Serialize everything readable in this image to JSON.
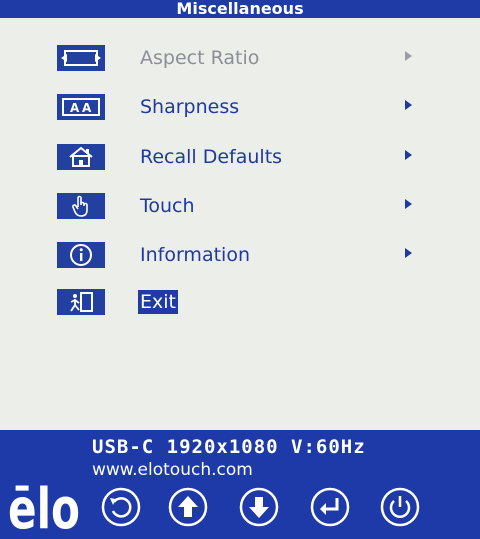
{
  "window": {
    "title": "Miscellaneous"
  },
  "menu": {
    "items": [
      {
        "label": "Aspect Ratio",
        "icon": "aspect-ratio-icon",
        "state": "disabled",
        "has_submenu": true
      },
      {
        "label": "Sharpness",
        "icon": "sharpness-icon",
        "state": "normal",
        "has_submenu": true
      },
      {
        "label": "Recall Defaults",
        "icon": "home-icon",
        "state": "normal",
        "has_submenu": true
      },
      {
        "label": "Touch",
        "icon": "touch-hand-icon",
        "state": "normal",
        "has_submenu": true
      },
      {
        "label": "Information",
        "icon": "info-icon",
        "state": "normal",
        "has_submenu": true
      },
      {
        "label": "Exit",
        "icon": "exit-door-icon",
        "state": "selected",
        "has_submenu": false
      }
    ]
  },
  "footer": {
    "brand": "ēlo",
    "model_line": "USB-C 1920x1080 V:60Hz",
    "url": "www.elotouch.com",
    "buttons": [
      {
        "icon": "back-icon"
      },
      {
        "icon": "up-arrow-icon"
      },
      {
        "icon": "down-arrow-icon"
      },
      {
        "icon": "enter-icon"
      },
      {
        "icon": "power-icon"
      }
    ]
  },
  "colors": {
    "panel_bg": "#eceeea",
    "brand_blue": "#1d3aa8",
    "label_blue": "#1e3a9e",
    "disabled_gray": "#8a8f98"
  }
}
